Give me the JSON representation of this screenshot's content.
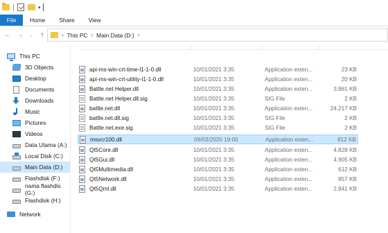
{
  "ribbon": {
    "tabs": [
      {
        "label": "File",
        "active": true
      },
      {
        "label": "Home"
      },
      {
        "label": "Share"
      },
      {
        "label": "View"
      }
    ]
  },
  "address": {
    "crumbs": [
      "This PC",
      "Main Data (D:)"
    ]
  },
  "nav": {
    "items": [
      {
        "label": "This PC",
        "icon": "computer-icon"
      },
      {
        "label": "3D Objects",
        "icon": "cube-icon"
      },
      {
        "label": "Desktop",
        "icon": "desktop-icon"
      },
      {
        "label": "Documents",
        "icon": "document-icon"
      },
      {
        "label": "Downloads",
        "icon": "download-icon"
      },
      {
        "label": "Music",
        "icon": "music-note-icon"
      },
      {
        "label": "Pictures",
        "icon": "picture-icon"
      },
      {
        "label": "Videos",
        "icon": "video-icon"
      },
      {
        "label": "Data Utama (A:)",
        "icon": "drive-icon"
      },
      {
        "label": "Local Disk (C:)",
        "icon": "windows-drive-icon"
      },
      {
        "label": "Main Data (D:)",
        "icon": "drive-icon",
        "selected": true
      },
      {
        "label": "Flashdisk (F:)",
        "icon": "drive-icon"
      },
      {
        "label": "nama flashdis (G:)",
        "icon": "drive-icon"
      },
      {
        "label": "Flashdisk (H:)",
        "icon": "drive-icon"
      },
      {
        "label": "Network",
        "icon": "network-icon"
      }
    ]
  },
  "files": [
    {
      "name": "api-ms-win-crt-time-l1-1-0.dll",
      "date": "10/01/2021 3:35",
      "type": "Application exten...",
      "size": "23 KB",
      "icon": "dll-file-icon"
    },
    {
      "name": "api-ms-win-crt-utility-l1-1-0.dll",
      "date": "10/01/2021 3:35",
      "type": "Application exten...",
      "size": "20 KB",
      "icon": "dll-file-icon"
    },
    {
      "name": "Battle.net Helper.dll",
      "date": "10/01/2021 3:35",
      "type": "Application exten...",
      "size": "3.861 KB",
      "icon": "dll-file-icon"
    },
    {
      "name": "Battle.net Helper.dll.sig",
      "date": "10/01/2021 3:35",
      "type": "SIG File",
      "size": "2 KB",
      "icon": "sig-file-icon"
    },
    {
      "name": "battle.net.dll",
      "date": "10/01/2021 3:35",
      "type": "Application exten...",
      "size": "24.217 KB",
      "icon": "dll-file-icon"
    },
    {
      "name": "battle.net.dll.sig",
      "date": "10/01/2021 3:35",
      "type": "SIG File",
      "size": "2 KB",
      "icon": "sig-file-icon"
    },
    {
      "name": "Battle.net.exe.sig",
      "date": "10/01/2021 3:35",
      "type": "SIG File",
      "size": "2 KB",
      "icon": "sig-file-icon"
    },
    {
      "name": "msvcr100.dll",
      "date": "09/03/2020 19:00",
      "type": "Application exten...",
      "size": "812 KB",
      "icon": "dll-file-icon",
      "selected": true
    },
    {
      "name": "Qt5Core.dll",
      "date": "10/01/2021 3:35",
      "type": "Application exten...",
      "size": "4.828 KB",
      "icon": "dll-file-icon"
    },
    {
      "name": "Qt5Gui.dll",
      "date": "10/01/2021 3:35",
      "type": "Application exten...",
      "size": "4.905 KB",
      "icon": "dll-file-icon"
    },
    {
      "name": "Qt5Multimedia.dll",
      "date": "10/01/2021 3:35",
      "type": "Application exten...",
      "size": "612 KB",
      "icon": "dll-file-icon"
    },
    {
      "name": "Qt5Network.dll",
      "date": "10/01/2021 3:35",
      "type": "Application exten...",
      "size": "857 KB",
      "icon": "dll-file-icon"
    },
    {
      "name": "Qt5Qml.dll",
      "date": "10/01/2021 3:35",
      "type": "Application exten...",
      "size": "2.841 KB",
      "icon": "dll-file-icon"
    }
  ]
}
